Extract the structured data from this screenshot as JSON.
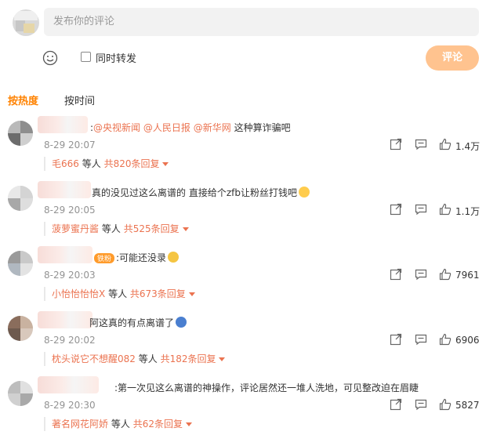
{
  "composer": {
    "placeholder": "发布你的评论",
    "repost_label": "同时转发",
    "submit_label": "评论"
  },
  "sort": {
    "hot_label": "按热度",
    "time_label": "按时间"
  },
  "comments": [
    {
      "prefix": ":",
      "mentions": [
        "@央视新闻",
        "@人民日报",
        "@新华网"
      ],
      "text": "这种算诈骗吧",
      "time": "8-29 20:07",
      "likes": "1.4万",
      "reply_name": "毛666",
      "reply_suffix": "等人",
      "reply_total": "共820条回复"
    },
    {
      "text": "真的没见过这么离谱的 直接给个zfb让粉丝打钱吧",
      "emoji": "😷",
      "time": "8-29 20:05",
      "likes": "1.1万",
      "reply_name": "菠萝蜜丹酱",
      "reply_suffix": "等人",
      "reply_total": "共525条回复"
    },
    {
      "badge": "铁粉",
      "text": ":可能还没录",
      "emoji": "😸",
      "time": "8-29 20:03",
      "likes": "7961",
      "reply_name": "小怡怡怡怡X",
      "reply_suffix": "等人",
      "reply_total": "共673条回复"
    },
    {
      "text": "阿这真的有点离谱了",
      "emoji": "🐳",
      "time": "8-29 20:02",
      "likes": "6906",
      "reply_name": "枕头说它不想醒082",
      "reply_suffix": "等人",
      "reply_total": "共182条回复"
    },
    {
      "text": ":第一次见这么离谱的神操作，评论居然还一堆人洗地，可见整改迫在眉睫",
      "time": "8-29 20:30",
      "likes": "5827",
      "reply_name": "著名网花阿娇",
      "reply_suffix": "等人",
      "reply_total": "共62条回复"
    }
  ],
  "colors": {
    "accent": "#ff8200",
    "link": "#eb7350",
    "submit_bg": "#ffc38f",
    "muted": "#939393"
  }
}
